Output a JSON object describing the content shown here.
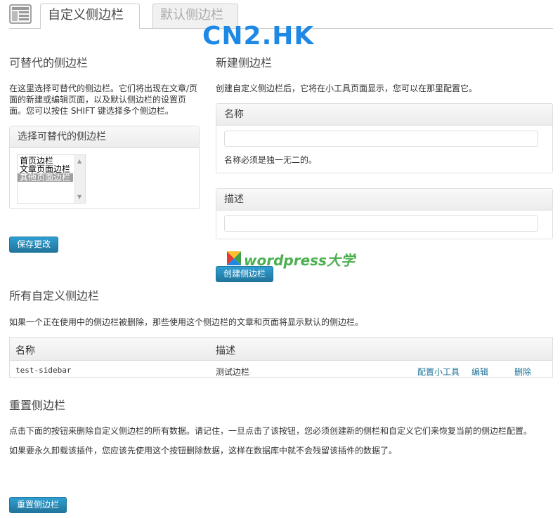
{
  "tabs": [
    {
      "label": "自定义侧边栏",
      "active": true
    },
    {
      "label": "默认侧边栏",
      "active": false
    }
  ],
  "watermark": "CN2.HK",
  "replaceable": {
    "heading": "可替代的侧边栏",
    "description": "在这里选择可替代的侧边栏。它们将出现在文章/页面的新建或编辑页面，以及默认侧边栏的设置页面。您可以按住 SHIFT 键选择多个侧边栏。",
    "box_title": "选择可替代的侧边栏",
    "options": [
      "首页边栏",
      "文章页面边栏",
      "其他页面边栏"
    ],
    "selected_index": 2,
    "save_label": "保存更改"
  },
  "new_sidebar": {
    "heading": "新建侧边栏",
    "description": "创建自定义侧边栏后，它将在小工具页面显示，您可以在那里配置它。",
    "name_label": "名称",
    "name_value": "",
    "name_hint": "名称必须是独一无二的。",
    "desc_label": "描述",
    "desc_value": "",
    "create_label": "创建侧边栏"
  },
  "wp_brand": "wordpress大学",
  "all_sidebars": {
    "heading": "所有自定义侧边栏",
    "description": "如果一个正在使用中的侧边栏被删除，那些使用这个侧边栏的文章和页面将显示默认的侧边栏。",
    "columns": [
      "名称",
      "描述"
    ],
    "rows": [
      {
        "name": "test-sidebar",
        "description": "测试边栏",
        "actions": [
          "配置小工具",
          "编辑",
          "删除"
        ]
      }
    ]
  },
  "reset": {
    "heading": "重置侧边栏",
    "line1": "点击下面的按钮来删除自定义侧边栏的所有数据。请记住，一旦点击了该按钮，您必须创建新的侧栏和自定义它们来恢复当前的侧边栏配置。",
    "line2": "如果要永久卸载该插件，您应该先使用这个按钮删除数据，这样在数据库中就不会残留该插件的数据了。",
    "button_label": "重置侧边栏"
  },
  "colors": {
    "accent": "#21759b",
    "watermark": "#1e88e5",
    "brand_green": "#4caf50"
  }
}
